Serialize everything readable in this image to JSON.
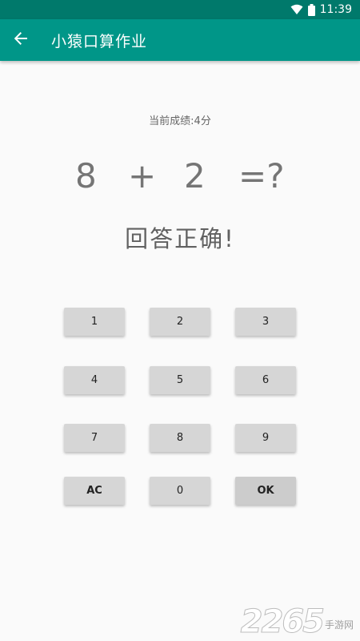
{
  "status_bar": {
    "time": "11:39",
    "icons": [
      "wifi-icon",
      "battery-icon"
    ]
  },
  "app_bar": {
    "title": "小猿口算作业",
    "back_icon": "arrow-left-icon",
    "color": "#009688"
  },
  "quiz": {
    "score": "当前成绩:4分",
    "operand_a": "8",
    "operator": "+",
    "operand_b": "2",
    "equals_prompt": "=?",
    "result": "回答正确!"
  },
  "keypad": {
    "keys": [
      "1",
      "2",
      "3",
      "4",
      "5",
      "6",
      "7",
      "8",
      "9",
      "AC",
      "0",
      "OK"
    ]
  },
  "watermark": {
    "number": "2265",
    "text": "手游网"
  }
}
